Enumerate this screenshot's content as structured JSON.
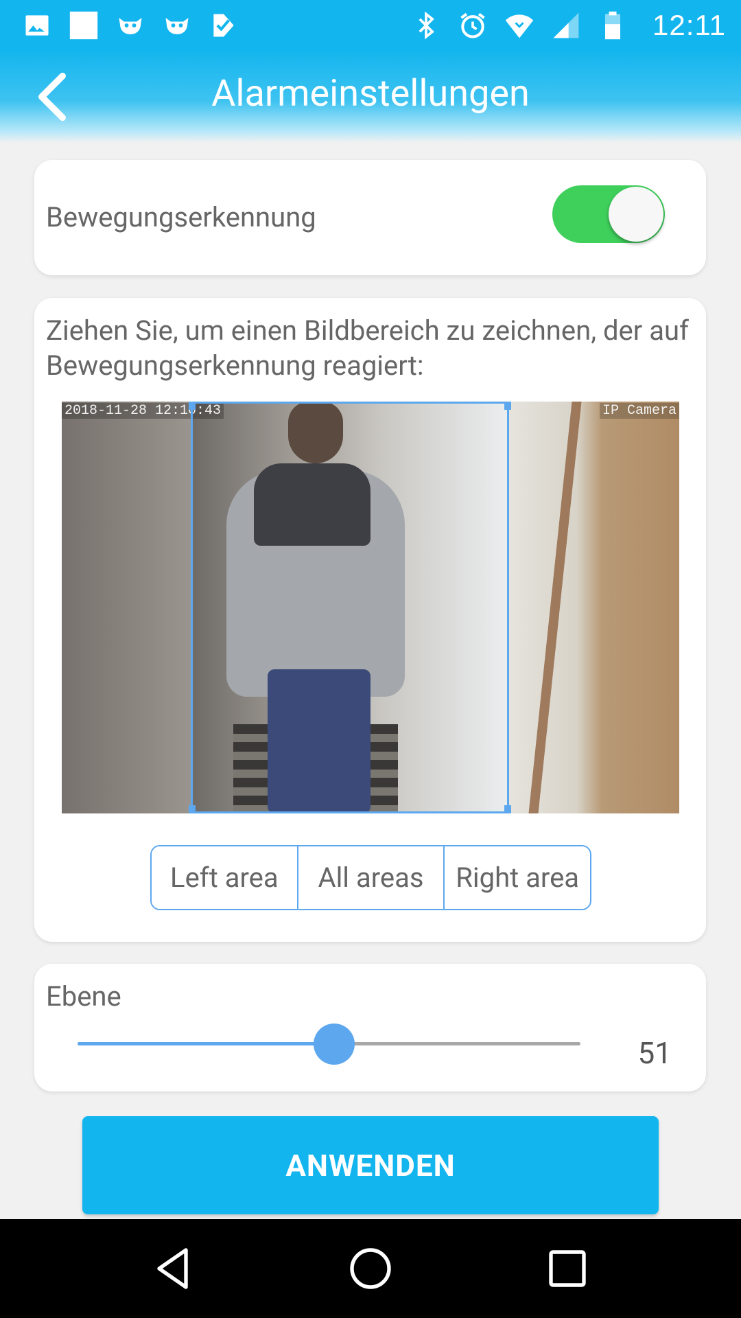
{
  "status_bar": {
    "time": "12:11",
    "left_icons": [
      "image-icon",
      "white-square-icon",
      "monster-icon",
      "monster-icon",
      "check-icon"
    ],
    "right_icons": [
      "bluetooth-icon",
      "alarm-icon",
      "wifi-icon",
      "signal-icon",
      "battery-icon"
    ]
  },
  "header": {
    "title": "Alarmeinstellungen",
    "back_icon": "back-arrow-icon"
  },
  "motion": {
    "label": "Bewegungserkennung",
    "enabled": true,
    "toggle_color": "#3fd05c"
  },
  "area": {
    "instructions": "Ziehen Sie, um einen Bildbereich zu zeichnen, der auf Bewegungserkennung reagiert:",
    "camera_timestamp": "2018-11-28 12:10:43",
    "camera_label": "IP Camera",
    "buttons": {
      "left": "Left area",
      "all": "All areas",
      "right": "Right area"
    }
  },
  "level": {
    "label": "Ebene",
    "value": "51",
    "fraction": 0.51
  },
  "apply": {
    "label": "ANWENDEN"
  },
  "colors": {
    "accent": "#13b5ee",
    "selection": "#5da7ee",
    "toggle_on": "#3fd05c"
  },
  "nav": {
    "icons": [
      "back-triangle-icon",
      "home-circle-icon",
      "recents-square-icon"
    ]
  }
}
